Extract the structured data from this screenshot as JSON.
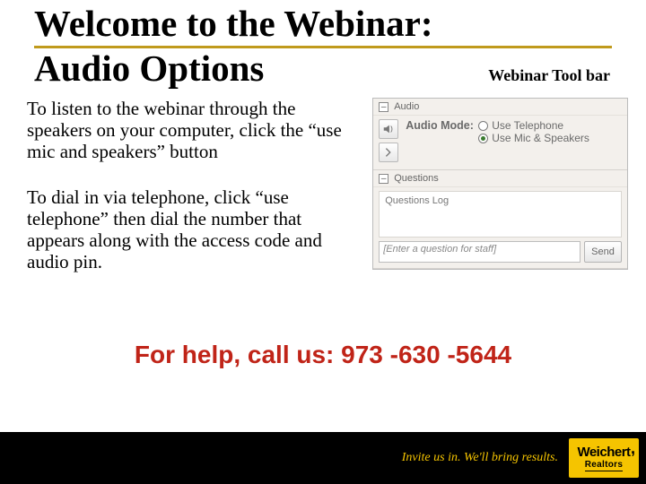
{
  "title": {
    "line1": "Welcome to the Webinar:",
    "line2": "Audio Options"
  },
  "toolbar_caption": "Webinar Tool bar",
  "instructions": {
    "p1": "To listen to the webinar through the speakers on your computer, click the “use mic and speakers” button",
    "p2": "To dial in via telephone, click “use telephone” then dial the number that appears along with the access code and audio pin."
  },
  "toolbar": {
    "audio": {
      "header": "Audio",
      "mode_label": "Audio Mode:",
      "opt_telephone": "Use Telephone",
      "opt_mic": "Use Mic & Speakers"
    },
    "questions": {
      "header": "Questions",
      "log_label": "Questions Log",
      "input_placeholder": "[Enter a question for staff]",
      "send_label": "Send"
    }
  },
  "help_line": "For help, call us:  973 -630 -5644",
  "footer": {
    "tagline": "Invite us in. We'll bring results.",
    "logo": {
      "line1": "Weichert",
      "line2": "Realtors"
    }
  }
}
